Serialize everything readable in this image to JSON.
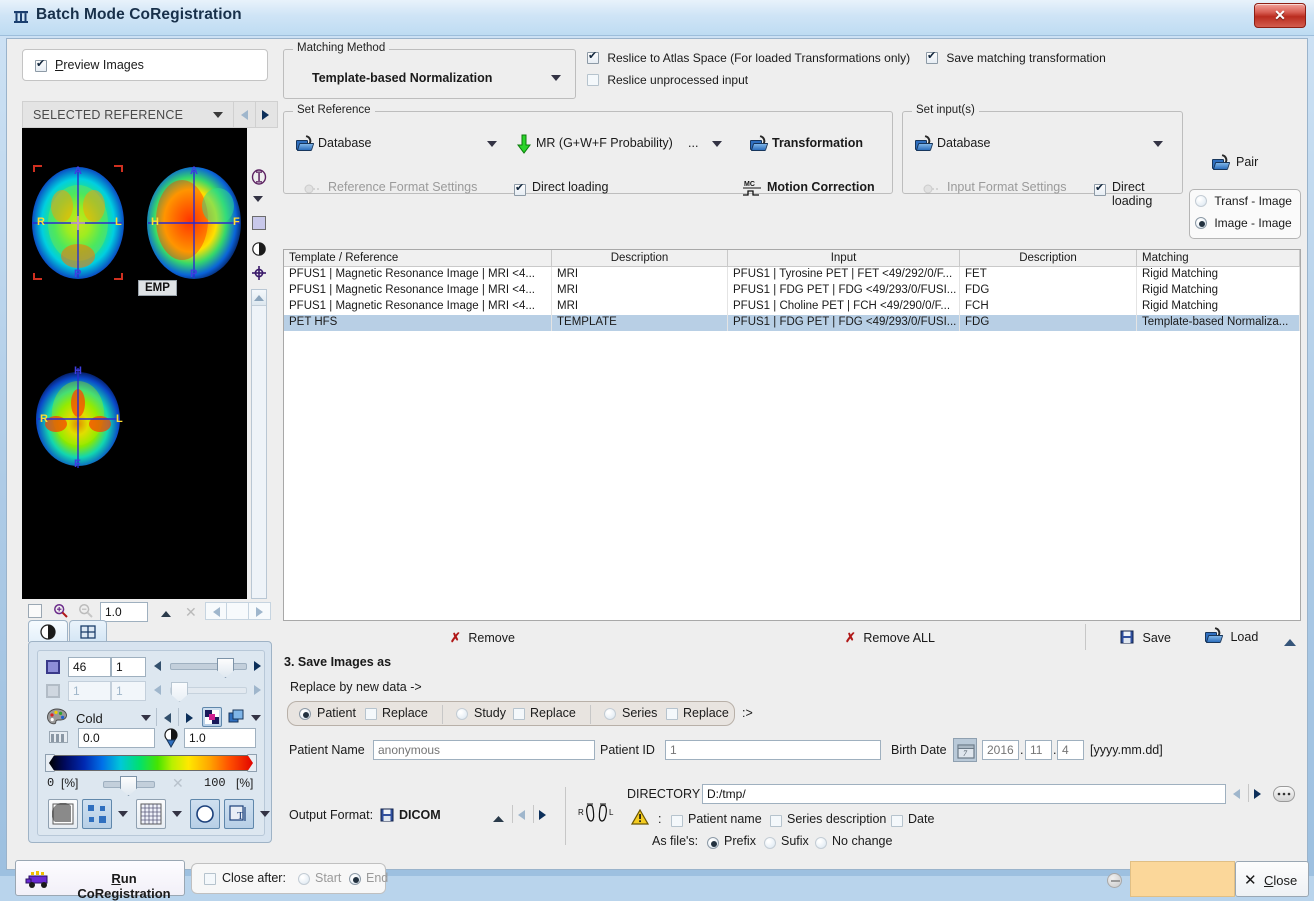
{
  "window": {
    "title": "Batch Mode CoRegistration",
    "close_button": "✕",
    "title_icon": "batch-coregistration-icon"
  },
  "preview": {
    "checkbox_label": "Preview Images",
    "checkbox_checked": true,
    "selector_label": "SELECTED REFERENCE",
    "overlay_tag": "EMP",
    "zoom_value": "1.0",
    "side_icons": [
      "info-icon",
      "chevron-down-icon",
      "square-color-icon",
      "contrast-icon",
      "crosshair-icon"
    ]
  },
  "matching": {
    "legend": "Matching Method",
    "selected_method": "Template-based Normalization"
  },
  "options": {
    "reslice_atlas": {
      "label": "Reslice to Atlas Space (For loaded Transformations only)",
      "checked": true
    },
    "save_matching": {
      "label": "Save matching transformation",
      "checked": true
    },
    "reslice_unprocessed": {
      "label": "Reslice unprocessed input",
      "checked": false
    }
  },
  "set_reference": {
    "legend": "Set Reference",
    "source": "Database",
    "probability": "MR (G+W+F Probability)",
    "ellipsis": "...",
    "transformation": "Transformation",
    "format_settings": "Reference Format Settings",
    "direct_loading": {
      "label": "Direct loading",
      "checked": true
    },
    "motion_correction": "Motion Correction",
    "motion_icon_text": "MC"
  },
  "set_inputs": {
    "legend": "Set input(s)",
    "source": "Database",
    "format_settings": "Input Format Settings",
    "direct_loading": {
      "label": "Direct loading",
      "checked": true
    }
  },
  "pair": {
    "label": "Pair",
    "options": [
      {
        "label": "Transf - Image",
        "selected": false
      },
      {
        "label": "Image - Image",
        "selected": true
      }
    ]
  },
  "table": {
    "columns": [
      "Template / Reference",
      "Description",
      "Input",
      "Description",
      "Matching"
    ],
    "rows": [
      {
        "reference": "PFUS1 | Magnetic Resonance Image | MRI <4...",
        "description": "MRI",
        "input": "PFUS1 | Tyrosine PET | FET <49/292/0/F...",
        "input_description": "FET",
        "matching": "Rigid Matching",
        "selected": false
      },
      {
        "reference": "PFUS1 | Magnetic Resonance Image | MRI <4...",
        "description": "MRI",
        "input": "PFUS1 | FDG PET | FDG <49/293/0/FUSI...",
        "input_description": "FDG",
        "matching": "Rigid Matching",
        "selected": false
      },
      {
        "reference": "PFUS1 | Magnetic Resonance Image | MRI <4...",
        "description": "MRI",
        "input": "PFUS1 | Choline PET | FCH <49/290/0/F...",
        "input_description": "FCH",
        "matching": "Rigid Matching",
        "selected": false
      },
      {
        "reference": "PET HFS",
        "description": "TEMPLATE",
        "input": "PFUS1 | FDG PET | FDG <49/293/0/FUSI...",
        "input_description": "FDG",
        "matching": "Template-based Normaliza...",
        "selected": true
      }
    ]
  },
  "table_actions": {
    "remove": "Remove",
    "remove_all": "Remove ALL",
    "save": "Save",
    "load": "Load"
  },
  "save_section": {
    "title": "3. Save Images as",
    "replace_hint": "Replace by new data ->",
    "arrow_suffix": ":>",
    "scope": [
      {
        "label": "Patient",
        "selected": true,
        "replace_label": "Replace",
        "replace_checked": false
      },
      {
        "label": "Study",
        "selected": false,
        "replace_label": "Replace",
        "replace_checked": false
      },
      {
        "label": "Series",
        "selected": false,
        "replace_label": "Replace",
        "replace_checked": false
      }
    ],
    "patient_name_label": "Patient Name",
    "patient_name_placeholder": "anonymous",
    "patient_id_label": "Patient ID",
    "patient_id_placeholder": "1",
    "birth_date_label": "Birth Date",
    "birth_year": "2016",
    "birth_month": "11",
    "birth_day": "4",
    "birth_format": "[yyyy.mm.dd]",
    "calendar_icon": "calendar-icon"
  },
  "output": {
    "format_label": "Output Format:",
    "format_value": "DICOM",
    "directory_label": "DIRECTORY",
    "directory_value": "D:/tmp/",
    "warn_colon": ":",
    "name_options": [
      {
        "label": "Patient name",
        "checked": false
      },
      {
        "label": "Series description",
        "checked": false
      },
      {
        "label": "Date",
        "checked": false
      }
    ],
    "as_files_label": "As file's:",
    "file_modes": [
      {
        "label": "Prefix",
        "selected": true
      },
      {
        "label": "Sufix",
        "selected": false
      },
      {
        "label": "No change",
        "selected": false
      }
    ]
  },
  "image_tools": {
    "tabs": [
      "contrast-tab",
      "layout-tab"
    ],
    "slice_index": "46",
    "slice_total": "1",
    "frame_index": "1",
    "frame_total": "1",
    "palette_name": "Cold",
    "min_value": "0.0",
    "max_value": "1.0",
    "range_min": "0",
    "range_min_unit": "[%]",
    "range_max": "100",
    "range_max_unit": "[%]"
  },
  "footer": {
    "run_label": "Run CoRegistration",
    "close_after_label": "Close after:",
    "close_after_checked": false,
    "start_label": "Start",
    "end_label": "End",
    "end_selected": true,
    "close_label": "Close"
  },
  "colors": {
    "accent": "#2f6fbf",
    "selection": "#b8cfe5",
    "progress": "#fbd79a",
    "warning": "#f2c200",
    "danger": "#b01818",
    "titlebar": "#cfe4f6"
  }
}
